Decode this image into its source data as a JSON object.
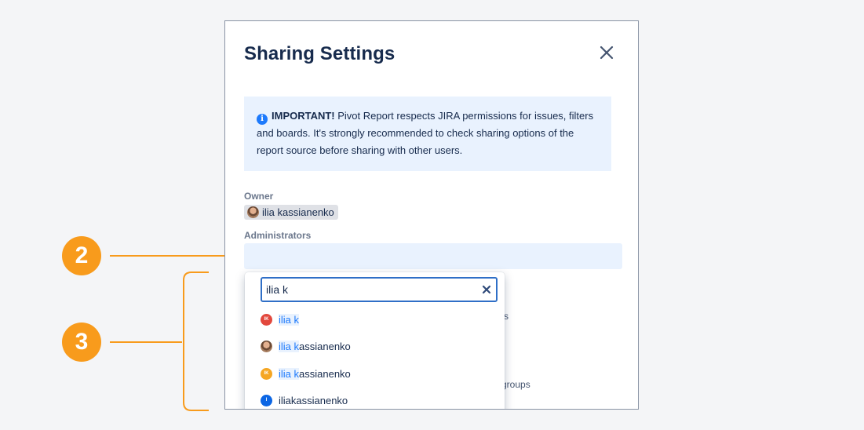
{
  "dialog": {
    "title": "Sharing Settings",
    "info": {
      "strong": "IMPORTANT!",
      "text": " Pivot Report respects JIRA permissions for issues, filters and boards. It's strongly recommended to check sharing options of the report source before sharing with other users."
    },
    "owner_label": "Owner",
    "owner_name": "ilia kassianenko",
    "admins_label": "Administrators",
    "bg_fragments": [
      "s",
      "groups"
    ]
  },
  "dropdown": {
    "search_value": "ilia k",
    "options": [
      {
        "avatar_text": "IK",
        "avatar_color": "#e2483d",
        "match": "ilia k",
        "rest": ""
      },
      {
        "avatar_text": "",
        "avatar_color": "photo",
        "match": "ilia k",
        "rest": "assianenko"
      },
      {
        "avatar_text": "IK",
        "avatar_color": "#f5a623",
        "match": "ilia k",
        "rest": "assianenko"
      },
      {
        "avatar_text": "I",
        "avatar_color": "#0c66e4",
        "match": "",
        "rest": "iliakassianenko"
      }
    ]
  },
  "callouts": [
    "2",
    "3"
  ],
  "colors": {
    "accent": "#f89b1c",
    "info_bg": "#e9f2fe",
    "link": "#1d7afc"
  }
}
